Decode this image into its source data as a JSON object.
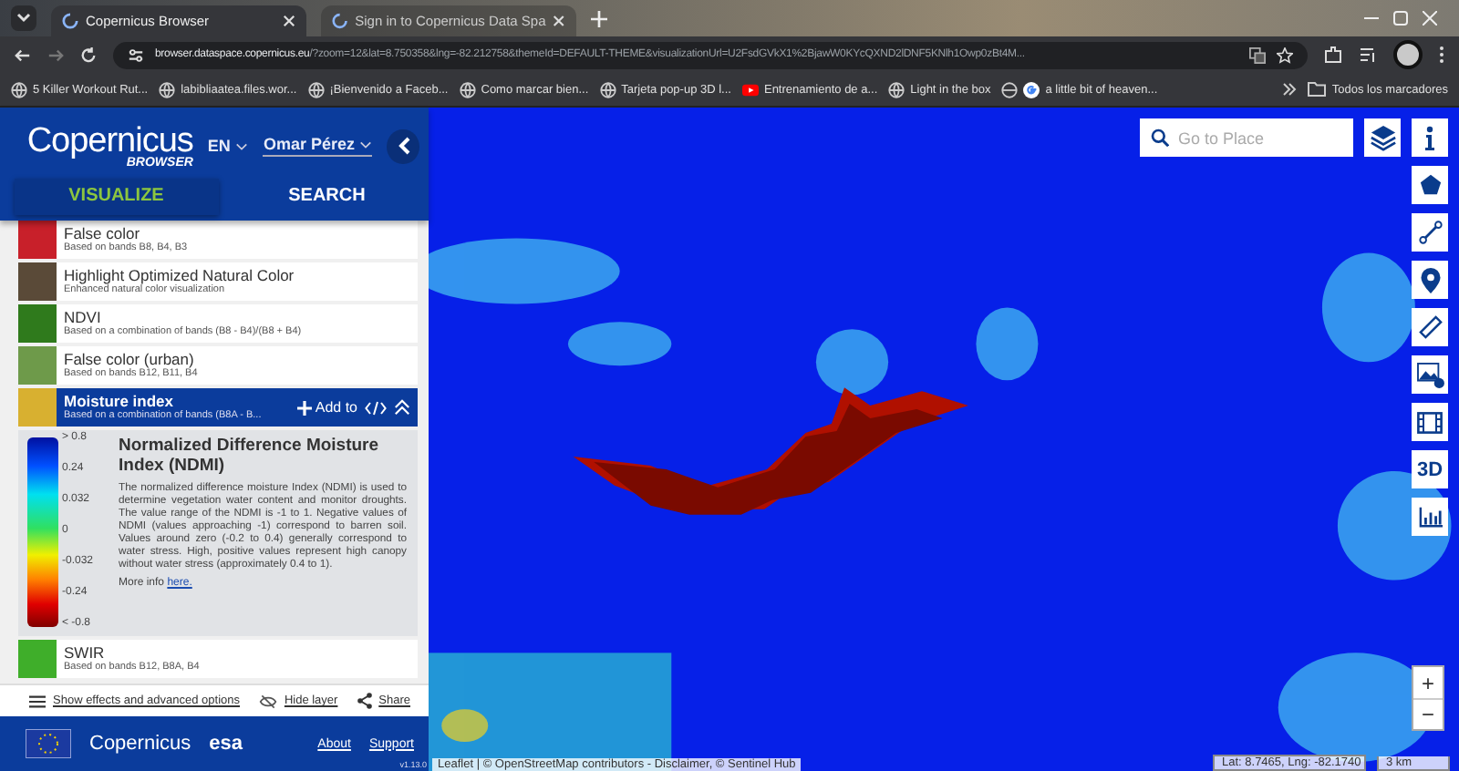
{
  "browser": {
    "tabs": [
      {
        "title": "Copernicus Browser",
        "selected": true
      },
      {
        "title": "Sign in to Copernicus Data Spa",
        "selected": false
      }
    ],
    "url_host": "browser.dataspace.copernicus.eu",
    "url_rest": "/?zoom=12&lat=8.750358&lng=-82.212758&themeId=DEFAULT-THEME&visualizationUrl=U2FsdGVkX1%2BjawW0KYcQXND2lDNF5KNlh1Owp0zBt4M...",
    "bookmarks": [
      {
        "label": "5 Killer Workout Rut...",
        "kind": "globe"
      },
      {
        "label": "labibliaatea.files.wor...",
        "kind": "globe"
      },
      {
        "label": "¡Bienvenido a Faceb...",
        "kind": "globe"
      },
      {
        "label": "Como marcar bien...",
        "kind": "globe"
      },
      {
        "label": "Tarjeta pop-up 3D l...",
        "kind": "globe"
      },
      {
        "label": "Entrenamiento de a...",
        "kind": "video"
      },
      {
        "label": "Light in the box",
        "kind": "globe"
      },
      {
        "label": "a little bit of heaven...",
        "kind": "search"
      }
    ],
    "all_bookmarks": "Todos los marcadores"
  },
  "header": {
    "logo": "Copernicus",
    "logo_sub": "BROWSER",
    "language": "EN",
    "user": "Omar Pérez",
    "tabs": [
      {
        "label": "VISUALIZE",
        "selected": true
      },
      {
        "label": "SEARCH",
        "selected": false
      }
    ]
  },
  "layers": [
    {
      "title": "False color",
      "subtitle": "Based on bands B8, B4, B3",
      "selected": false,
      "color": "#c8202a"
    },
    {
      "title": "Highlight Optimized Natural Color",
      "subtitle": "Enhanced natural color visualization",
      "selected": false,
      "color": "#5a4a38"
    },
    {
      "title": "NDVI",
      "subtitle": "Based on a combination of bands (B8 - B4)/(B8 + B4)",
      "selected": false,
      "color": "#2f7a1c"
    },
    {
      "title": "False color (urban)",
      "subtitle": "Based on bands B12, B11, B4",
      "selected": false,
      "color": "#6e9a4a"
    },
    {
      "title": "Moisture index",
      "subtitle": "Based on a combination of bands (B8A - B...",
      "selected": true,
      "color": "#d8b030",
      "add_label": "Add to"
    },
    {
      "title": "SWIR",
      "subtitle": "Based on bands B12, B8A, B4",
      "selected": false,
      "color": "#3fae2a"
    }
  ],
  "description": {
    "legend": [
      "> 0.8",
      "0.24",
      "0.032",
      "0",
      "-0.032",
      "-0.24",
      "< -0.8"
    ],
    "title": "Normalized Difference Moisture Index (NDMI)",
    "text": "The normalized difference moisture Index (NDMI) is used to determine vegetation water content and monitor droughts. The value range of the NDMI is -1 to 1. Negative values of NDMI (values approaching -1) correspond to barren soil. Values around zero (-0.2 to 0.4) generally correspond to water stress. High, positive values represent high canopy without water stress (approximately 0.4 to 1).",
    "more_info": "More info",
    "link": "here."
  },
  "actions": [
    {
      "label": "Show effects and advanced options",
      "kind": "effects"
    },
    {
      "label": "Hide layer",
      "kind": "hide"
    },
    {
      "label": "Share",
      "kind": "share"
    }
  ],
  "footer": {
    "copernicus": "Copernicus",
    "esa": "esa",
    "links": [
      "About",
      "Support"
    ],
    "version": "v1.13.0"
  },
  "map": {
    "search_placeholder": "Go to Place",
    "tools": [
      {
        "kind": "info"
      },
      {
        "kind": "polygon"
      },
      {
        "kind": "line"
      },
      {
        "kind": "pin"
      },
      {
        "kind": "ruler"
      },
      {
        "kind": "image"
      },
      {
        "kind": "film"
      },
      {
        "kind": "text",
        "label": "3D"
      },
      {
        "kind": "chart"
      }
    ],
    "zoom_in": "+",
    "zoom_out": "−",
    "coords": "Lat: 8.7465, Lng: -82.1740",
    "scale": "3 km",
    "attribution": "Leaflet | © OpenStreetMap contributors - Disclaimer, © Sentinel Hub"
  }
}
